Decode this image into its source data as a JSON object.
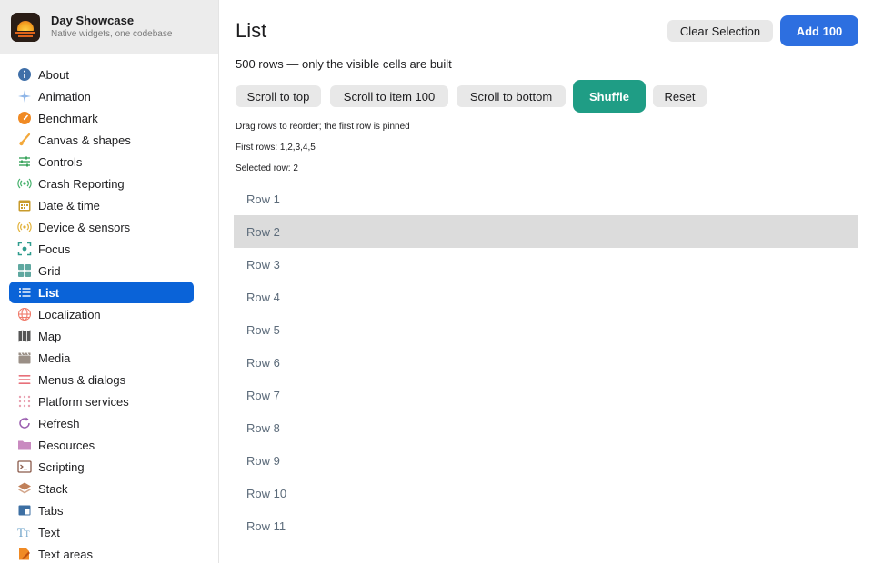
{
  "app": {
    "name": "Day Showcase",
    "subtitle": "Native widgets, one codebase"
  },
  "sidebar": {
    "items": [
      {
        "label": "About",
        "icon": "info-icon",
        "color": "#3f6fa8"
      },
      {
        "label": "Animation",
        "icon": "sparkles-icon",
        "color": "#8fb6e8"
      },
      {
        "label": "Benchmark",
        "icon": "speedometer-icon",
        "color": "#f08a24"
      },
      {
        "label": "Canvas & shapes",
        "icon": "brush-icon",
        "color": "#f3a83a"
      },
      {
        "label": "Controls",
        "icon": "sliders-icon",
        "color": "#3aa45c"
      },
      {
        "label": "Crash Reporting",
        "icon": "broadcast-icon",
        "color": "#44b06b"
      },
      {
        "label": "Date & time",
        "icon": "calendar-icon",
        "color": "#c89b2b"
      },
      {
        "label": "Device & sensors",
        "icon": "sensor-icon",
        "color": "#e2b23a"
      },
      {
        "label": "Focus",
        "icon": "focus-icon",
        "color": "#2f9c8e"
      },
      {
        "label": "Grid",
        "icon": "grid-icon",
        "color": "#5fa8a0"
      },
      {
        "label": "List",
        "icon": "list-icon",
        "color": "#ffffff",
        "active": true
      },
      {
        "label": "Localization",
        "icon": "globe-icon",
        "color": "#f07a6a"
      },
      {
        "label": "Map",
        "icon": "map-icon",
        "color": "#555555"
      },
      {
        "label": "Media",
        "icon": "clapper-icon",
        "color": "#9a8f86"
      },
      {
        "label": "Menus & dialogs",
        "icon": "menu-lines-icon",
        "color": "#e8707a"
      },
      {
        "label": "Platform services",
        "icon": "dots-grid-icon",
        "color": "#e8a0b0"
      },
      {
        "label": "Refresh",
        "icon": "refresh-icon",
        "color": "#9b5fb0"
      },
      {
        "label": "Resources",
        "icon": "folder-icon",
        "color": "#c98ac0"
      },
      {
        "label": "Scripting",
        "icon": "terminal-icon",
        "color": "#8a5a4a"
      },
      {
        "label": "Stack",
        "icon": "layers-icon",
        "color": "#c0805a"
      },
      {
        "label": "Tabs",
        "icon": "tabs-icon",
        "color": "#3d6fa3"
      },
      {
        "label": "Text",
        "icon": "text-size-icon",
        "color": "#6aa0c8"
      },
      {
        "label": "Text areas",
        "icon": "document-edit-icon",
        "color": "#f08a24"
      }
    ]
  },
  "main": {
    "title": "List",
    "clear_selection": "Clear Selection",
    "add_100": "Add 100",
    "summary": "500 rows — only the visible cells are built",
    "actions": {
      "scroll_top": "Scroll to top",
      "scroll_item": "Scroll to item 100",
      "scroll_bottom": "Scroll to bottom",
      "shuffle": "Shuffle",
      "reset": "Reset"
    },
    "drag_note": "Drag rows to reorder; the first row is pinned",
    "first_rows": "First rows: 1,2,3,4,5",
    "selected_row": "Selected row: 2",
    "rows": [
      "Row 1",
      "Row 2",
      "Row 3",
      "Row 4",
      "Row 5",
      "Row 6",
      "Row 7",
      "Row 8",
      "Row 9",
      "Row 10",
      "Row 11"
    ],
    "selected_index": 1
  },
  "colors": {
    "accent": "#0a63d8",
    "primary_button": "#2d6fe0",
    "shuffle_button": "#1f9d85",
    "selected_row": "#dcdcdc"
  }
}
